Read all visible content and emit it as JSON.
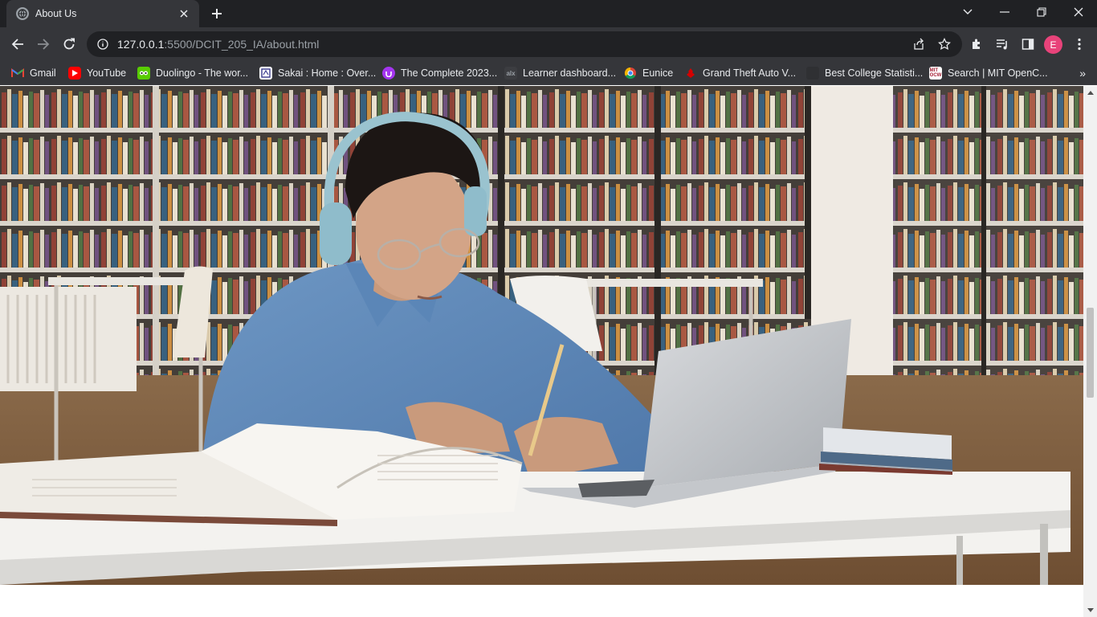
{
  "browser": {
    "tab": {
      "title": "About Us"
    },
    "url": {
      "host": "127.0.0.1",
      "path": ":5500/DCIT_205_IA/about.html"
    },
    "profile_initial": "E",
    "bookmarks": [
      {
        "label": "Gmail",
        "icon": "gmail-icon",
        "color": "#ea4335"
      },
      {
        "label": "YouTube",
        "icon": "youtube-icon",
        "color": "#ff0000"
      },
      {
        "label": "Duolingo - The wor...",
        "icon": "duolingo-icon",
        "color": "#58cc02"
      },
      {
        "label": "Sakai : Home : Over...",
        "icon": "sakai-icon",
        "color": "#ffffff"
      },
      {
        "label": "The Complete 2023...",
        "icon": "udemy-icon",
        "color": "#a435f0"
      },
      {
        "label": "Learner dashboard...",
        "icon": "alx-icon",
        "color": "#3c3d41"
      },
      {
        "label": "Eunice",
        "icon": "chrome-profile-icon",
        "color": "#4285f4"
      },
      {
        "label": "Grand Theft Auto V...",
        "icon": "gta-icon",
        "color": "#d50000"
      },
      {
        "label": "Best College Statisti...",
        "icon": "college-icon",
        "color": "#3c3d41"
      },
      {
        "label": "Search | MIT OpenC...",
        "icon": "mit-ocw-icon",
        "color": "#a31f34"
      }
    ],
    "bookmarks_more": "»"
  },
  "page": {
    "hero_alt": "Student studying in library with headphones, laptop and books"
  }
}
